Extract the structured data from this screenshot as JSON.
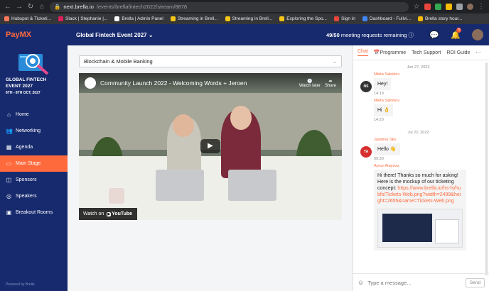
{
  "browser": {
    "url_host": "next.brella.io",
    "url_path": "/events/brellafintech2022/stream/8878",
    "bookmarks": [
      "Hubspot & Ticketi...",
      "Slack | Stephanie |...",
      "Brella | Admin Panel",
      "Streaming in Brell...",
      "Streaming in Brell...",
      "Exploring the Spo...",
      "Sign in",
      "Dashboard - Fullvi...",
      "Brella story hour..."
    ]
  },
  "header": {
    "logo": "PayMX",
    "event": "Global Fintech Event 2027",
    "meetings_count": "49/50",
    "meetings_text": "meeting requests remaining",
    "notif_badge": "5"
  },
  "sidebar": {
    "event_title": "GLOBAL FINTECH EVENT 2027",
    "event_date": "6TH - 8TH OCT, 2027",
    "items": [
      {
        "label": "Home",
        "icon": "home-icon"
      },
      {
        "label": "Networking",
        "icon": "people-icon"
      },
      {
        "label": "Agenda",
        "icon": "calendar-icon"
      },
      {
        "label": "Main Stage",
        "icon": "stage-icon",
        "active": true
      },
      {
        "label": "Sponsors",
        "icon": "sponsors-icon"
      },
      {
        "label": "Speakers",
        "icon": "speakers-icon"
      },
      {
        "label": "Breakout Rooms",
        "icon": "rooms-icon"
      }
    ],
    "powered": "Powered by Brella"
  },
  "main": {
    "stage_select": "Blockchain & Mobile Banking",
    "video_title": "Community Launch 2022 - Welcoming Words + Jeroen",
    "watch_later": "Watch later",
    "share": "Share",
    "watch_on": "Watch on",
    "youtube": "YouTube"
  },
  "chat": {
    "tabs": [
      "Chat",
      "Programme",
      "Tech Support",
      "ROI Guide"
    ],
    "date1": "Jun 27, 2022",
    "date2": "Jul 22, 2022",
    "messages": [
      {
        "sender": "Nikita Salnikov",
        "text": "Hey!",
        "time": "14:19",
        "initials": "NS"
      },
      {
        "sender": "Nikita Salnikov",
        "text": "Hi 👌",
        "time": "14:20"
      },
      {
        "sender": "Jasmine Sko",
        "text": "Hello 👋",
        "time": "09:30",
        "initials": "YA"
      },
      {
        "sender": "Aynur Ataysva",
        "text": "Hi there! Thanks so much for asking! Here is the mockup of our ticketing concept:",
        "link": "https://www.brella.io/hs-fs/hubfs/Tickets-Web.png?width=2499&height=2655&name=Tickets-Web.png"
      }
    ],
    "placeholder": "Type a message...",
    "send": "Send"
  }
}
